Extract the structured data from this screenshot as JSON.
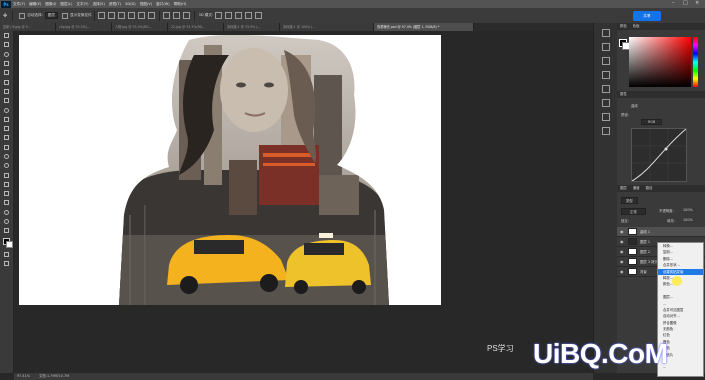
{
  "menubar": {
    "items": [
      "文件(F)",
      "编辑(E)",
      "图像(I)",
      "图层(L)",
      "文字(Y)",
      "选择(S)",
      "滤镜(T)",
      "3D(D)",
      "视图(V)",
      "窗口(W)",
      "帮助(H)"
    ]
  },
  "options": {
    "auto_select_label": "自动选择:",
    "auto_select_value": "图层",
    "transform_label": "显示变换控件",
    "mode_label": "3D 模式:",
    "share_label": "共享"
  },
  "tabs": [
    {
      "label": "复制 / 8.jpg @ 9...",
      "active": false
    },
    {
      "label": "city.jpg @ 33.3%(...",
      "active": false
    },
    {
      "label": "人物.jpg @ 33.3%(RG...",
      "active": false
    },
    {
      "label": "22.jpg @ 33.3%(RG...",
      "active": false
    },
    {
      "label": "未标题-1 @ 33.3% (...",
      "active": false
    },
    {
      "label": "未标题-1 @ 100% (...",
      "active": false
    },
    {
      "label": "双重曝光.psd @ 97.4% (图层 1, RGB/8) *",
      "active": true
    }
  ],
  "panels": {
    "color_tabs": [
      "颜色",
      "色板"
    ],
    "props_tabs": [
      "属性"
    ],
    "curves_label": "曲线",
    "preset_label": "预设:",
    "channel_value": "RGB",
    "layers_tabs": [
      "图层",
      "通道",
      "路径"
    ],
    "kind_label": "类型",
    "blend_mode": "正常",
    "opacity_label": "不透明度:",
    "opacity_value": "100%",
    "lock_label": "锁定:",
    "fill_label": "填充:",
    "fill_value": "100%",
    "layers": [
      {
        "name": "曲线 1",
        "selected": true,
        "dark": false
      },
      {
        "name": "图层 1",
        "selected": false,
        "dark": true
      },
      {
        "name": "图层 2",
        "selected": false,
        "dark": false
      },
      {
        "name": "图层 3 拷贝",
        "selected": false,
        "dark": false
      },
      {
        "name": "背景",
        "selected": false,
        "dark": false
      }
    ]
  },
  "context_menu": {
    "items": [
      {
        "label": "转换...",
        "highlight": false
      },
      {
        "label": "复制...",
        "highlight": false
      },
      {
        "label": "删除...",
        "highlight": false
      },
      {
        "label": "合并形状...",
        "highlight": false
      },
      {
        "label": "创建剪贴蒙版",
        "highlight": true
      },
      {
        "label": "释放...",
        "highlight": false
      },
      {
        "label": "颜色...",
        "highlight": false
      },
      {
        "label": "",
        "highlight": false
      },
      {
        "label": "图层...",
        "highlight": false
      },
      {
        "label": "...",
        "highlight": false
      },
      {
        "label": "合并可见图层",
        "highlight": false
      },
      {
        "label": "自动对齐...",
        "highlight": false
      },
      {
        "label": "拼合图像",
        "highlight": false
      },
      {
        "label": "无颜色",
        "highlight": false
      },
      {
        "label": "红色",
        "highlight": false
      },
      {
        "label": "橙色",
        "highlight": false
      },
      {
        "label": "黄色",
        "highlight": false
      },
      {
        "label": "明信片",
        "highlight": false
      },
      {
        "label": "...",
        "highlight": false
      },
      {
        "label": "...",
        "highlight": false
      }
    ]
  },
  "status": {
    "zoom": "97.41%",
    "doc": "文档:1.79M/10.7M"
  },
  "watermark": {
    "brand": "UiBQ.CoM",
    "ps_text": "PS学习"
  },
  "icons": {
    "accent": "#1473e6",
    "highlight": "#1e7ae6"
  }
}
